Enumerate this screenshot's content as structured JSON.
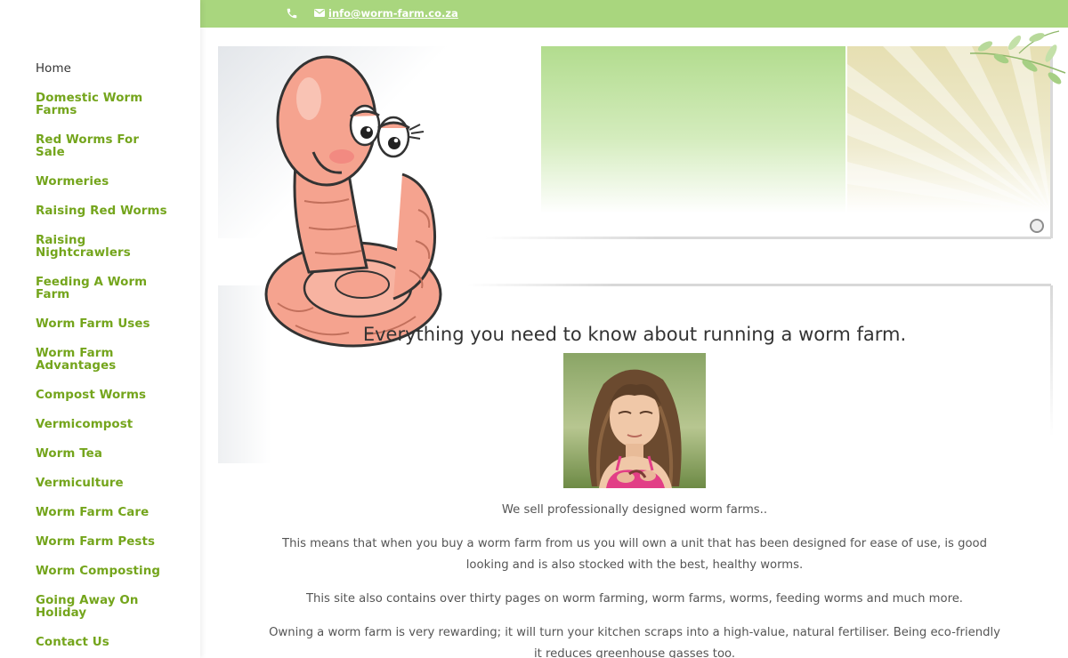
{
  "topbar": {
    "email": "info@worm-farm.co.za",
    "background_color": "#a9d67e",
    "phone_icon": "phone-icon",
    "mail_icon": "envelope-icon"
  },
  "nav": {
    "link_color": "#74a51c",
    "items": [
      {
        "label": "Home",
        "active": true
      },
      {
        "label": "Domestic Worm Farms"
      },
      {
        "label": "Red Worms For Sale"
      },
      {
        "label": "Wormeries"
      },
      {
        "label": "Raising Red Worms"
      },
      {
        "label": "Raising Nightcrawlers"
      },
      {
        "label": "Feeding A Worm Farm"
      },
      {
        "label": "Worm Farm Uses"
      },
      {
        "label": "Worm Farm Advantages"
      },
      {
        "label": "Compost Worms"
      },
      {
        "label": "Vermicompost"
      },
      {
        "label": "Worm Tea"
      },
      {
        "label": "Vermiculture"
      },
      {
        "label": "Worm Farm Care"
      },
      {
        "label": "Worm Farm Pests"
      },
      {
        "label": "Worm Composting"
      },
      {
        "label": "Going Away On Holiday"
      },
      {
        "label": "Contact Us"
      }
    ]
  },
  "main": {
    "headline": "Everything you need to know about running a worm farm.",
    "paragraphs": [
      "We sell professionally designed worm farms..",
      "This means that when you buy a worm farm from us you will own a unit that has been designed for ease of use, is good looking and is also stocked with the best, healthy worms.",
      "This site also contains over thirty pages on worm farming, worm farms, worms, feeding worms and much more.",
      "Owning a worm farm is very rewarding; it will turn your kitchen scraps into a high-value, natural fertiliser. Being eco-friendly it reduces greenhouse gasses too."
    ]
  }
}
